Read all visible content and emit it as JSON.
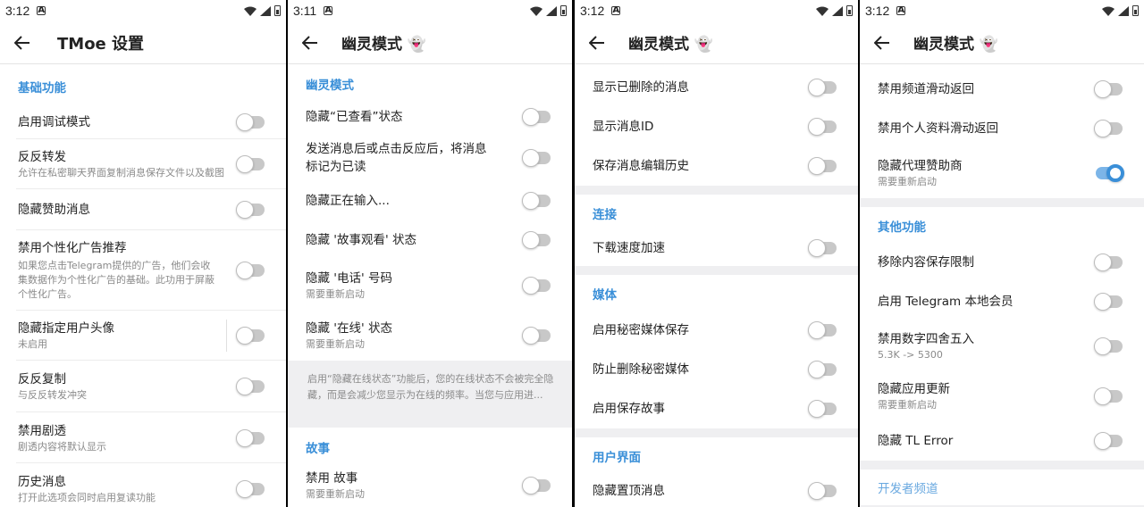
{
  "status": {
    "s1": {
      "time": "3:12"
    },
    "s2": {
      "time": "3:11"
    },
    "s3": {
      "time": "3:12"
    },
    "s4": {
      "time": "3:12"
    }
  },
  "icons": {
    "back": "arrow-left-icon",
    "ghost": "ghost-emoji",
    "wifi": "wifi-icon",
    "signal": "signal-icon",
    "battery": "battery-icon"
  },
  "colors": {
    "accent": "#3a8fd8",
    "toggle_on_track": "#7cb5e8",
    "toggle_off_track": "#c8c8c8"
  },
  "screen1": {
    "title": "TMoe 设置",
    "section": "基础功能",
    "rows": [
      {
        "label": "启用调试模式",
        "on": false
      },
      {
        "label": "反反转发",
        "sub": "允许在私密聊天界面复制消息保存文件以及截图",
        "on": false
      },
      {
        "label": "隐藏赞助消息",
        "on": false
      },
      {
        "label": "禁用个性化广告推荐",
        "sub": "如果您点击Telegram提供的广告，他们会收集数据作为个性化广告的基础。此功用于屏蔽个性化广告。",
        "on": false
      },
      {
        "label": "隐藏指定用户头像",
        "sub": "未启用",
        "on": false
      },
      {
        "label": "反反复制",
        "sub": "与反反转发冲突",
        "on": false
      },
      {
        "label": "禁用剧透",
        "sub": "剧透内容将默认显示",
        "on": false
      },
      {
        "label": "历史消息",
        "sub": "打开此选项会同时启用复读功能",
        "on": false
      }
    ]
  },
  "screen2": {
    "title": "幽灵模式 👻",
    "section": "幽灵模式",
    "rows": [
      {
        "label": "隐藏“已查看”状态",
        "on": false
      },
      {
        "label": "发送消息后或点击反应后，将消息标记为已读",
        "on": false
      },
      {
        "label": "隐藏正在输入...",
        "on": false
      },
      {
        "label": "隐藏 '故事观看' 状态",
        "on": false
      },
      {
        "label": "隐藏 '电话' 号码",
        "sub": "需要重新启动",
        "on": false
      },
      {
        "label": "隐藏 '在线' 状态",
        "sub": "需要重新启动",
        "on": false
      }
    ],
    "info": "启用“隐藏在线状态”功能后，您的在线状态不会被完全隐藏，而是会减少您显示为在线的频率。当您与应用进...",
    "section2": "故事",
    "rows2": [
      {
        "label": "禁用 故事",
        "sub": "需要重新启动",
        "on": false
      }
    ]
  },
  "screen3": {
    "title": "幽灵模式 👻",
    "rows": [
      {
        "label": "显示已删除的消息",
        "on": false
      },
      {
        "label": "显示消息ID",
        "on": false
      },
      {
        "label": "保存消息编辑历史",
        "on": false
      }
    ],
    "section_conn": "连接",
    "rows_conn": [
      {
        "label": "下载速度加速",
        "on": false
      }
    ],
    "section_media": "媒体",
    "rows_media": [
      {
        "label": "启用秘密媒体保存",
        "on": false
      },
      {
        "label": "防止删除秘密媒体",
        "on": false
      },
      {
        "label": "启用保存故事",
        "on": false
      }
    ],
    "section_ui": "用户界面",
    "rows_ui": [
      {
        "label": "隐藏置顶消息",
        "on": false
      }
    ]
  },
  "screen4": {
    "title": "幽灵模式 👻",
    "rows": [
      {
        "label": "禁用频道滑动返回",
        "on": false
      },
      {
        "label": "禁用个人资料滑动返回",
        "on": false
      },
      {
        "label": "隐藏代理赞助商",
        "sub": "需要重新启动",
        "on": true
      }
    ],
    "section_other": "其他功能",
    "rows_other": [
      {
        "label": "移除内容保存限制",
        "on": false
      },
      {
        "label": "启用 Telegram 本地会员",
        "on": false
      },
      {
        "label": "禁用数字四舍五入",
        "sub": "5.3K -> 5300",
        "on": false
      },
      {
        "label": "隐藏应用更新",
        "sub": "需要重新启动",
        "on": false
      },
      {
        "label": "隐藏 TL Error",
        "on": false
      }
    ],
    "section_dev": "开发者频道"
  }
}
